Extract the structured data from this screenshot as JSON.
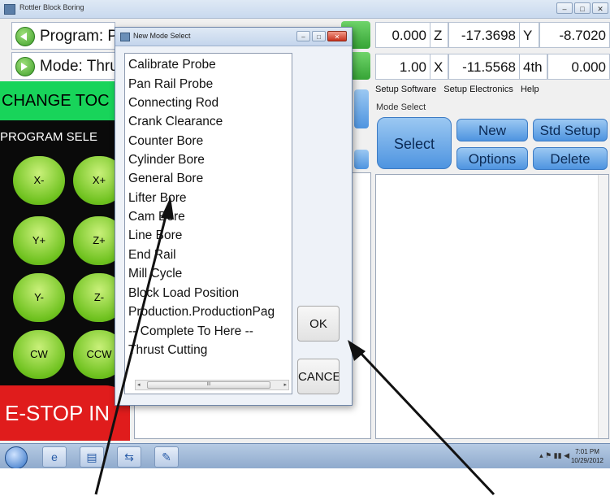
{
  "window": {
    "title": "Rottler Block Boring",
    "buttons": [
      "–",
      "□",
      "✕"
    ]
  },
  "left": {
    "program_label": "Program: Pa",
    "mode_label": "Mode: Thru",
    "change_tool": "CHANGE TOC",
    "program_select": "PROGRAM SELE",
    "jog_buttons": [
      "X-",
      "X+",
      "Y+",
      "Z+",
      "Y-",
      "Z-",
      "CW",
      "CCW"
    ],
    "estop": "E-STOP IN"
  },
  "coords": {
    "row1": {
      "v1": "0.000",
      "a1": "Z",
      "v2": "-17.3698",
      "a2": "Y",
      "v3": "-8.7020"
    },
    "row2": {
      "v1": "1.00",
      "a1": "X",
      "v2": "-11.5568",
      "a2": "4th",
      "v3": "0.000"
    }
  },
  "menu": {
    "items": [
      "Setup Software",
      "Setup Electronics",
      "Help"
    ],
    "mode_select_label": "Mode Select"
  },
  "mode_buttons": {
    "select": "Select",
    "new": "New",
    "std_setup": "Std Setup",
    "options": "Options",
    "delete": "Delete"
  },
  "dialog": {
    "title": "New Mode Select",
    "items": [
      "Calibrate Probe",
      "Pan Rail Probe",
      "Connecting Rod",
      "Crank Clearance",
      "Counter Bore",
      "Cylinder Bore",
      "General Bore",
      "Lifter Bore",
      "Cam Bore",
      "Line Bore",
      "End Rail",
      "Mill Cycle",
      "Block Load Position",
      "Production.ProductionPag",
      "-- Complete To Here --",
      "Thrust Cutting"
    ],
    "ok": "OK",
    "cancel": "CANCE",
    "scroll_thumb": "III"
  },
  "taskbar": {
    "time": "7:01 PM",
    "date": "10/29/2012"
  },
  "colors": {
    "accent_green": "#18d45a",
    "estop_red": "#e01c1c",
    "mode_blue": "#4e94e0"
  }
}
